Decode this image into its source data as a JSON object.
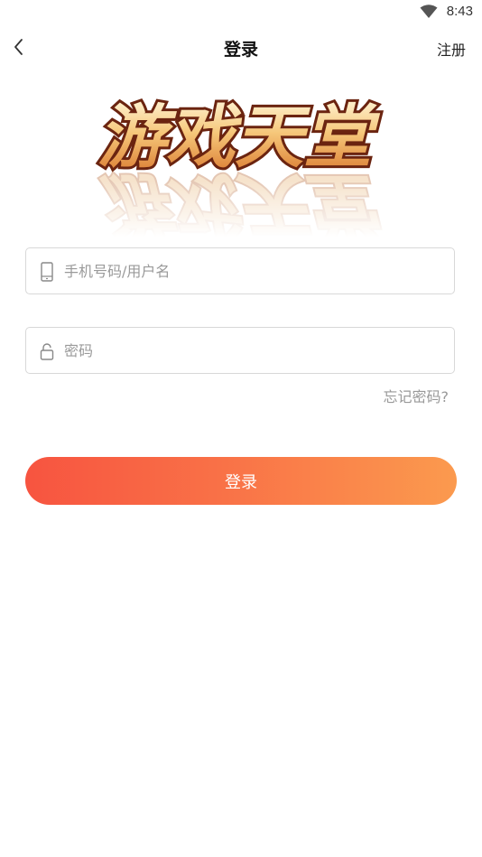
{
  "status_bar": {
    "time": "8:43",
    "wifi_icon": "wifi-icon"
  },
  "nav": {
    "back_icon": "chevron-left-icon",
    "title": "登录",
    "register_label": "注册"
  },
  "logo": {
    "text": "游戏天堂",
    "colors": {
      "fill_top": "#fff1c9",
      "fill_bottom": "#e0913b",
      "outline": "#7a2a12"
    }
  },
  "form": {
    "account": {
      "icon": "phone-icon",
      "placeholder": "手机号码/用户名",
      "value": ""
    },
    "password": {
      "icon": "lock-icon",
      "placeholder": "密码",
      "value": ""
    },
    "forgot_label": "忘记密码?",
    "login_label": "登录"
  },
  "colors": {
    "button_gradient_start": "#f75440",
    "button_gradient_end": "#fb9a4e",
    "border": "#d8d8d8",
    "placeholder": "#9a9a9a"
  }
}
